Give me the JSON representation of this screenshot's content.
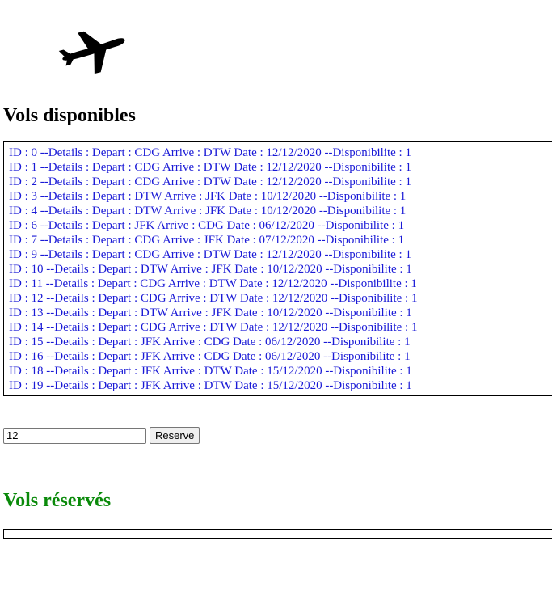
{
  "logo": {
    "icon": "airplane-icon"
  },
  "available": {
    "title": "Vols disponibles",
    "flights": [
      "ID : 0 --Details : Depart : CDG Arrive : DTW Date : 12/12/2020 --Disponibilite : 1",
      "ID : 1 --Details : Depart : CDG Arrive : DTW Date : 12/12/2020 --Disponibilite : 1",
      "ID : 2 --Details : Depart : CDG Arrive : DTW Date : 12/12/2020 --Disponibilite : 1",
      "ID : 3 --Details : Depart : DTW Arrive : JFK Date : 10/12/2020 --Disponibilite : 1",
      "ID : 4 --Details : Depart : DTW Arrive : JFK Date : 10/12/2020 --Disponibilite : 1",
      "ID : 6 --Details : Depart : JFK Arrive : CDG Date : 06/12/2020 --Disponibilite : 1",
      "ID : 7 --Details : Depart : CDG Arrive : JFK Date : 07/12/2020 --Disponibilite : 1",
      "ID : 9 --Details : Depart : CDG Arrive : DTW Date : 12/12/2020 --Disponibilite : 1",
      "ID : 10 --Details : Depart : DTW Arrive : JFK Date : 10/12/2020 --Disponibilite : 1",
      "ID : 11 --Details : Depart : CDG Arrive : DTW Date : 12/12/2020 --Disponibilite : 1",
      "ID : 12 --Details : Depart : CDG Arrive : DTW Date : 12/12/2020 --Disponibilite : 1",
      "ID : 13 --Details : Depart : DTW Arrive : JFK Date : 10/12/2020 --Disponibilite : 1",
      "ID : 14 --Details : Depart : CDG Arrive : DTW Date : 12/12/2020 --Disponibilite : 1",
      "ID : 15 --Details : Depart : JFK Arrive : CDG Date : 06/12/2020 --Disponibilite : 1",
      "ID : 16 --Details : Depart : JFK Arrive : CDG Date : 06/12/2020 --Disponibilite : 1",
      "ID : 18 --Details : Depart : JFK Arrive : DTW Date : 15/12/2020 --Disponibilite : 1",
      "ID : 19 --Details : Depart : JFK Arrive : DTW Date : 15/12/2020 --Disponibilite : 1"
    ]
  },
  "form": {
    "input_value": "12",
    "button_label": "Reserve"
  },
  "reserved": {
    "title": "Vols réservés",
    "flights": []
  },
  "colors": {
    "link": "#1a1ad6",
    "reserved_title": "#0a8a0a"
  }
}
